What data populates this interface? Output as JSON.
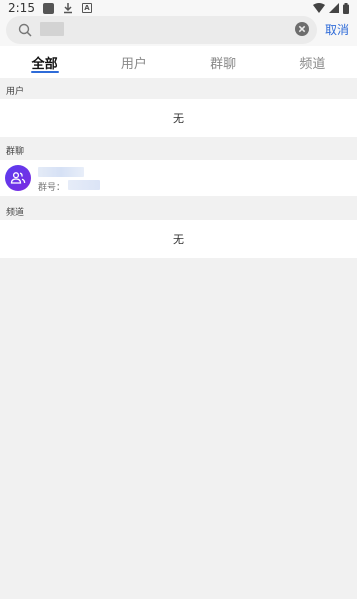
{
  "status_bar": {
    "time": "2:15",
    "left_icons": [
      "app-notification-icon",
      "download-icon",
      "a-badge-icon"
    ],
    "right_icons": [
      "wifi-icon",
      "signal-icon",
      "battery-icon"
    ]
  },
  "search": {
    "query": "██",
    "cancel_label": "取消"
  },
  "tabs": [
    {
      "label": "全部",
      "active": true
    },
    {
      "label": "用户",
      "active": false
    },
    {
      "label": "群聊",
      "active": false
    },
    {
      "label": "频道",
      "active": false
    }
  ],
  "sections": {
    "users": {
      "title": "用户",
      "empty_text": "无"
    },
    "groups": {
      "title": "群聊",
      "items": [
        {
          "name": "█████",
          "id_label": "群号：",
          "id_value": "████"
        }
      ]
    },
    "channels": {
      "title": "频道",
      "empty_text": "无"
    }
  },
  "colors": {
    "accent": "#2e6bd8",
    "avatar_start": "#5a3df0",
    "avatar_end": "#7c2ce0",
    "background": "#f1f1f1"
  }
}
